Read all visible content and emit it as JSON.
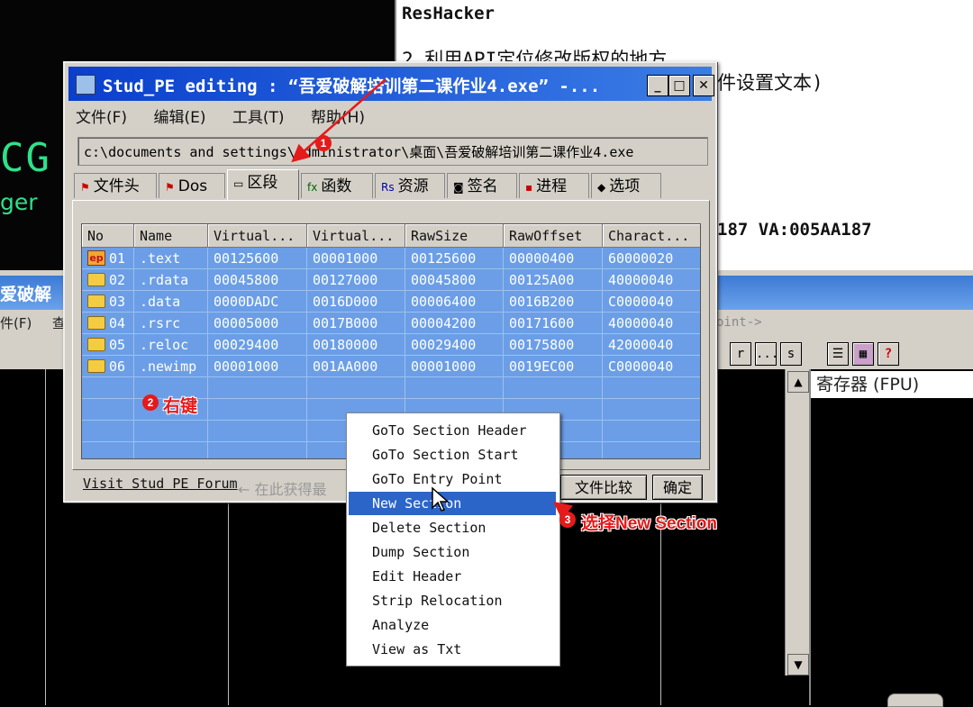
{
  "background": {
    "logo_cg": "CG",
    "logo_ger": "ger",
    "doc_lines": {
      "resh": "ResHacker",
      "step2": "2.利用API定位修改版权的地方",
      "ctrl": "件设置文本)",
      "va": "187 VA:005AA187"
    },
    "debugger": {
      "title": "爱破解",
      "menu1": "件(F)",
      "menu2": "查",
      "hint": "oint->",
      "toolbar": [
        "r",
        "...",
        "s",
        "☰",
        "▦",
        "?"
      ],
      "fpu_header": "寄存器 (FPU)"
    }
  },
  "window": {
    "title": "Stud_PE editing : “吾爱破解培训第二课作业4.exe” -...",
    "controls": {
      "minimize": "_",
      "maximize": "□",
      "close": "✕"
    },
    "menu": [
      "文件(F)",
      "编辑(E)",
      "工具(T)",
      "帮助(H)"
    ],
    "path": "c:\\documents and settings\\administrator\\桌面\\吾爱破解培训第二课作业4.exe",
    "tabs": [
      {
        "label": "文件头",
        "icon": "⚑"
      },
      {
        "label": "Dos",
        "icon": "⚑"
      },
      {
        "label": "区段",
        "icon": "▭"
      },
      {
        "label": "函数",
        "icon": "fx"
      },
      {
        "label": "资源",
        "icon": "Rs"
      },
      {
        "label": "签名",
        "icon": "◙"
      },
      {
        "label": "进程",
        "icon": "▪"
      },
      {
        "label": "选项",
        "icon": "◆"
      }
    ],
    "columns": [
      "No",
      "Name",
      "Virtual...",
      "Virtual...",
      "RawSize",
      "RawOffset",
      "Charact..."
    ],
    "rows": [
      {
        "no": "01",
        "name": ".text",
        "vsize": "00125600",
        "vaddr": "00001000",
        "rawsize": "00125600",
        "rawoff": "00000400",
        "chars": "60000020",
        "icon": "ep-icon"
      },
      {
        "no": "02",
        "name": ".rdata",
        "vsize": "00045800",
        "vaddr": "00127000",
        "rawsize": "00045800",
        "rawoff": "00125A00",
        "chars": "40000040",
        "icon": "folder-icon"
      },
      {
        "no": "03",
        "name": ".data",
        "vsize": "0000DADC",
        "vaddr": "0016D000",
        "rawsize": "00006400",
        "rawoff": "0016B200",
        "chars": "C0000040",
        "icon": "folder-icon"
      },
      {
        "no": "04",
        "name": ".rsrc",
        "vsize": "00005000",
        "vaddr": "0017B000",
        "rawsize": "00004200",
        "rawoff": "00171600",
        "chars": "40000040",
        "icon": "folder-icon"
      },
      {
        "no": "05",
        "name": ".reloc",
        "vsize": "00029400",
        "vaddr": "00180000",
        "rawsize": "00029400",
        "rawoff": "00175800",
        "chars": "42000040",
        "icon": "folder-icon"
      },
      {
        "no": "06",
        "name": ".newimp",
        "vsize": "00001000",
        "vaddr": "001AA000",
        "rawsize": "00001000",
        "rawoff": "0019EC00",
        "chars": "C0000040",
        "icon": "folder-icon"
      }
    ],
    "forum_link": "Visit Stud PE Forum",
    "forum_hint": "← 在此获得最",
    "compare_button": "文件比较",
    "ok_button": "确定"
  },
  "context_menu": [
    "GoTo Section Header",
    "GoTo Section Start",
    "GoTo Entry Point",
    "New Section",
    "Delete Section",
    "Dump Section",
    "Edit Header",
    "Strip Relocation",
    "Analyze",
    "View as Txt"
  ],
  "highlighted_menu_item": "New Section",
  "annotations": [
    {
      "badge": "1",
      "text": ""
    },
    {
      "badge": "2",
      "text": "右键"
    },
    {
      "badge": "3",
      "text": "选择New Section"
    }
  ],
  "annotation_color": "#e51a1a",
  "selection_color": "#2c65c8",
  "table_row_color": "#6b9ee6"
}
